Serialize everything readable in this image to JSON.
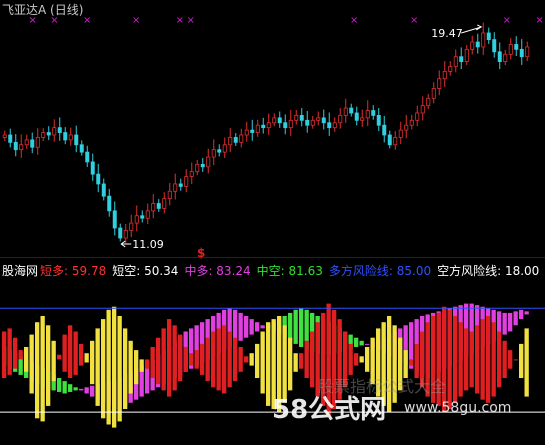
{
  "header": {
    "title": "飞亚达A (日线)",
    "title_color": "#c8c8c8"
  },
  "markers": {
    "symbol": "×",
    "color": "#d81bd8",
    "sell_symbol": "$",
    "sell_color": "#e02020"
  },
  "annotations": {
    "high_label": "19.47",
    "low_label": "11.09",
    "arrow_color": "#ffffff"
  },
  "indicator_legend": {
    "name": "股海网",
    "items": [
      {
        "label": "短多:",
        "value": "59.78",
        "color": "#ff3030"
      },
      {
        "label": "短空:",
        "value": "50.34",
        "color": "#ffffff"
      },
      {
        "label": "中多:",
        "value": "83.24",
        "color": "#e040e0"
      },
      {
        "label": "中空:",
        "value": "81.63",
        "color": "#30e030"
      },
      {
        "label": "多方风险线:",
        "value": "85.00",
        "color": "#3050ff"
      },
      {
        "label": "空方风险线:",
        "value": "18.00",
        "color": "#ffffff"
      }
    ]
  },
  "watermark": {
    "brand": "58公式网",
    "url": "www.58gu.com",
    "faint_text": "股票指标公式大全"
  },
  "colors": {
    "up": "#e03030",
    "down": "#30d0e0",
    "short_long": "#e02020",
    "short_short": "#f0e040",
    "mid_long": "#e040e0",
    "mid_short": "#40e040",
    "risk_long": "#3050ff",
    "risk_short": "#ffffff"
  },
  "chart_data": [
    {
      "type": "candlestick",
      "title": "飞亚达A (日线)",
      "ylim": [
        10.6,
        20.0
      ],
      "series": [
        {
          "name": "飞亚达A",
          "values": [
            15.3,
            15.0,
            14.7,
            14.9,
            15.1,
            14.8,
            15.2,
            15.4,
            15.3,
            15.6,
            15.4,
            15.1,
            15.3,
            14.9,
            14.6,
            14.2,
            13.7,
            13.3,
            12.8,
            12.2,
            11.5,
            11.09,
            11.4,
            11.7,
            12.0,
            11.9,
            12.2,
            12.5,
            12.3,
            12.7,
            13.0,
            13.3,
            13.2,
            13.6,
            13.8,
            14.1,
            14.0,
            14.4,
            14.7,
            14.6,
            14.9,
            15.2,
            15.0,
            15.3,
            15.5,
            15.4,
            15.7,
            15.6,
            15.8,
            16.0,
            15.8,
            15.6,
            15.9,
            16.1,
            15.9,
            15.7,
            15.9,
            16.0,
            15.8,
            15.6,
            15.8,
            16.1,
            16.4,
            16.2,
            15.9,
            16.0,
            16.3,
            16.1,
            15.7,
            15.3,
            14.9,
            15.2,
            15.5,
            15.7,
            15.9,
            16.2,
            16.5,
            16.8,
            17.2,
            17.6,
            17.9,
            18.1,
            18.5,
            18.3,
            18.8,
            19.1,
            18.9,
            19.47,
            19.2,
            18.7,
            18.3,
            18.6,
            19.0,
            18.8,
            18.5,
            18.9
          ]
        }
      ],
      "annotations": [
        {
          "label": "19.47",
          "value": 19.47
        },
        {
          "label": "11.09",
          "value": 11.09
        }
      ]
    },
    {
      "type": "bar",
      "title": "股海网",
      "ylim": [
        0,
        100
      ],
      "risk_lines": [
        85.0,
        18.0
      ],
      "series": [
        {
          "name": "短多",
          "values": [
            70,
            72,
            66,
            58,
            44,
            30,
            14,
            12,
            22,
            38,
            55,
            68,
            74,
            70,
            62,
            50,
            36,
            22,
            14,
            10,
            8,
            12,
            20,
            30,
            36,
            44,
            52,
            60,
            66,
            72,
            78,
            74,
            68,
            60,
            56,
            58,
            62,
            66,
            70,
            72,
            74,
            70,
            66,
            60,
            54,
            48,
            40,
            30,
            22,
            20,
            18,
            24,
            32,
            44,
            56,
            64,
            70,
            76,
            82,
            88,
            84,
            78,
            70,
            62,
            56,
            50,
            44,
            36,
            28,
            22,
            18,
            24,
            32,
            40,
            52,
            62,
            70,
            76,
            80,
            82,
            86,
            84,
            80,
            76,
            72,
            70,
            74,
            78,
            80,
            76,
            70,
            64,
            58,
            52,
            40,
            28
          ]
        },
        {
          "name": "短空",
          "values": [
            40,
            42,
            46,
            52,
            60,
            68,
            76,
            80,
            74,
            64,
            52,
            44,
            40,
            42,
            48,
            56,
            64,
            72,
            78,
            84,
            86,
            80,
            72,
            64,
            58,
            52,
            46,
            40,
            36,
            32,
            28,
            32,
            38,
            44,
            48,
            46,
            42,
            38,
            34,
            32,
            30,
            34,
            38,
            44,
            50,
            56,
            62,
            70,
            76,
            78,
            80,
            74,
            66,
            56,
            46,
            40,
            34,
            28,
            22,
            16,
            20,
            26,
            34,
            42,
            48,
            54,
            60,
            66,
            72,
            76,
            80,
            74,
            66,
            58,
            48,
            40,
            34,
            28,
            24,
            22,
            18,
            20,
            24,
            28,
            32,
            34,
            30,
            26,
            24,
            28,
            34,
            40,
            46,
            52,
            62,
            72
          ]
        },
        {
          "name": "中多",
          "values": [
            48,
            46,
            44,
            42,
            40,
            38,
            36,
            34,
            33,
            32,
            31,
            30,
            31,
            32,
            33,
            34,
            35,
            36,
            37,
            38,
            39,
            40,
            42,
            44,
            46,
            48,
            50,
            52,
            55,
            58,
            61,
            64,
            67,
            70,
            72,
            74,
            76,
            78,
            80,
            82,
            84,
            85,
            84,
            82,
            80,
            78,
            76,
            74,
            72,
            70,
            68,
            66,
            64,
            62,
            60,
            58,
            57,
            56,
            55,
            55,
            56,
            57,
            58,
            59,
            60,
            61,
            62,
            63,
            64,
            66,
            68,
            70,
            72,
            74,
            76,
            78,
            80,
            81,
            82,
            83,
            84,
            85,
            86,
            87,
            88,
            88,
            87,
            86,
            85,
            84,
            83,
            82,
            82,
            83,
            84,
            83
          ]
        },
        {
          "name": "中空",
          "values": [
            60,
            58,
            56,
            54,
            52,
            50,
            48,
            46,
            44,
            42,
            40,
            38,
            36,
            34,
            32,
            30,
            28,
            26,
            24,
            22,
            20,
            20,
            22,
            24,
            26,
            28,
            30,
            32,
            34,
            36,
            38,
            40,
            42,
            44,
            46,
            48,
            50,
            52,
            54,
            56,
            58,
            60,
            62,
            64,
            66,
            68,
            70,
            72,
            74,
            76,
            78,
            80,
            82,
            84,
            85,
            84,
            82,
            80,
            78,
            76,
            74,
            72,
            70,
            68,
            66,
            64,
            62,
            60,
            58,
            56,
            54,
            52,
            50,
            48,
            46,
            44,
            42,
            40,
            42,
            44,
            46,
            48,
            50,
            52,
            54,
            56,
            58,
            60,
            62,
            64,
            66,
            68,
            70,
            74,
            78,
            81
          ]
        }
      ]
    }
  ]
}
